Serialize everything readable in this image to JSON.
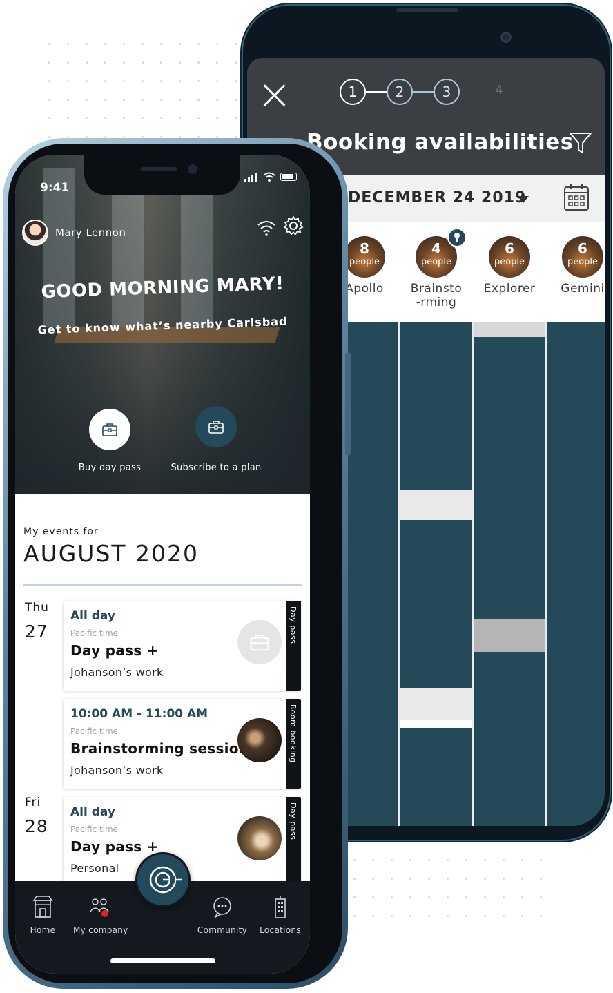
{
  "booking": {
    "steps": [
      "1",
      "2",
      "3",
      "4"
    ],
    "title": "Booking availabilities",
    "date": "DECEMBER 24 2019",
    "rooms": [
      {
        "count": "8",
        "unit": "people",
        "name": "Apollo"
      },
      {
        "count": "4",
        "unit": "people",
        "name": "Brainsto-rming"
      },
      {
        "count": "6",
        "unit": "people",
        "name": "Explorer"
      },
      {
        "count": "6",
        "unit": "people",
        "name": "Gemini"
      }
    ]
  },
  "app": {
    "status_time": "9:41",
    "user_name": "Mary Lennon",
    "greeting": "GOOD MORNING MARY!",
    "subgreeting": "Get to know what’s nearby Carlsbad",
    "actions": [
      {
        "label": "Buy  day pass",
        "icon": "briefcase-icon"
      },
      {
        "label": "Subscribe to a plan",
        "icon": "briefcase-icon"
      }
    ],
    "events_sub": "My events for",
    "events_month": "AUGUST 2020",
    "days": [
      {
        "name": "Thu",
        "num": "27"
      },
      {
        "name": "Fri",
        "num": "28"
      }
    ],
    "events": [
      {
        "time": "All day",
        "tz": "Pacific time",
        "title": "Day pass +",
        "place": "Johanson’s work",
        "tag": "Day pass"
      },
      {
        "time": "10:00 AM - 11:00 AM",
        "tz": "Pacific time",
        "title": "Brainstorming session",
        "place": "Johanson’s work",
        "tag": "Room booking"
      },
      {
        "time": "All day",
        "tz": "Pacific time",
        "title": "Day pass +",
        "place": "Personal",
        "tag": "Day pass"
      }
    ],
    "tabs": [
      {
        "label": "Home",
        "icon": "store-icon"
      },
      {
        "label": "My company",
        "icon": "team-icon"
      },
      {
        "label": "Community",
        "icon": "chat-icon"
      },
      {
        "label": "Locations",
        "icon": "building-icon"
      }
    ]
  },
  "colors": {
    "brand_teal": "#23495a",
    "grid_dark": "#244a5a",
    "booked_light": "#e9e9e9",
    "booked_grey": "#b5b5b5"
  }
}
